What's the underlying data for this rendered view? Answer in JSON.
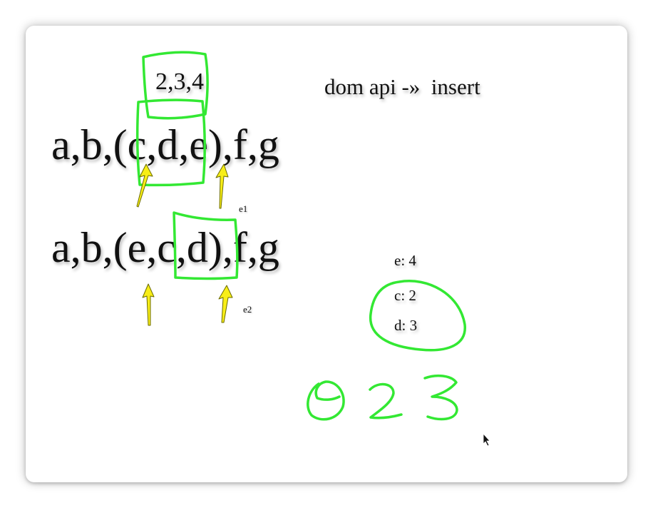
{
  "slide": {
    "top_label": "2,3,4",
    "dom_api_label": "dom api -»  insert",
    "sequence_old": "a,b,(c,d,e),f,g",
    "sequence_new": "a,b,(e,c,d),f,g",
    "marker_e1": "e1",
    "marker_e2": "e2",
    "map": [
      {
        "text": "e: 4"
      },
      {
        "text": "c: 2"
      },
      {
        "text": "d: 3"
      }
    ],
    "handwritten_note": "0 2 3",
    "annotation_color": "#33e833",
    "arrow_color": "#f8ee17"
  }
}
